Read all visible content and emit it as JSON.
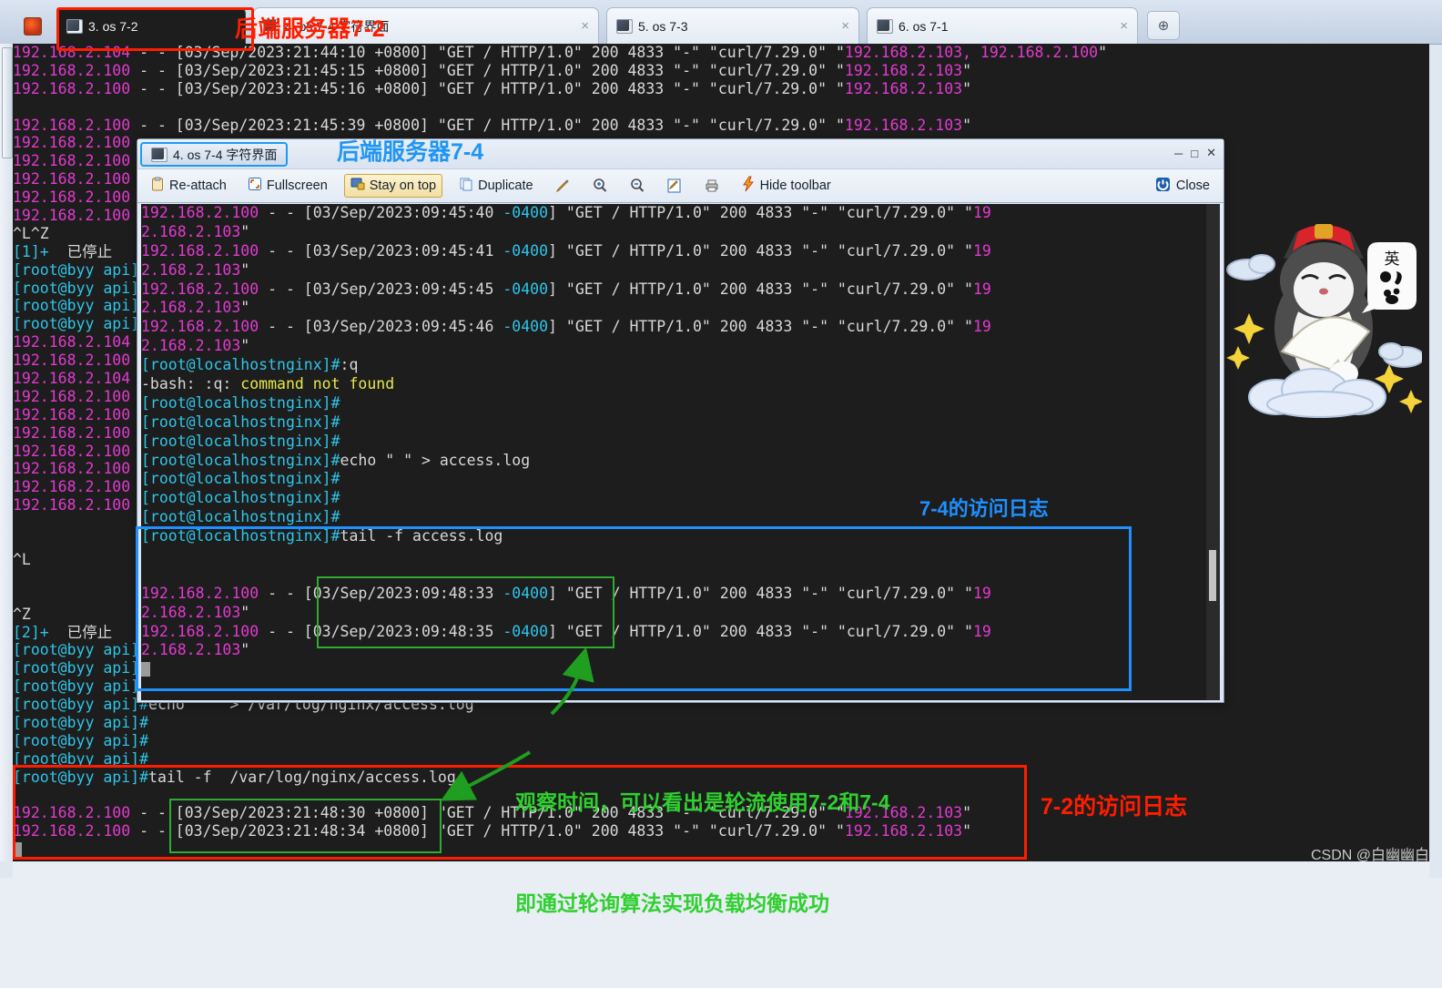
{
  "window": {
    "tabs": [
      {
        "label": "3. os 7-2",
        "icon": "monitor-icon",
        "active": true,
        "close": "×"
      },
      {
        "label": "4. os 7-4 字符界面",
        "icon": "monitor-icon",
        "active": false,
        "close": "×"
      },
      {
        "label": "5. os 7-3",
        "icon": "monitor-icon",
        "active": false,
        "close": "×"
      },
      {
        "label": "6. os 7-1",
        "icon": "monitor-icon",
        "active": false,
        "close": "×"
      }
    ],
    "new_tab_label": "⊕",
    "home_icon": "home-icon"
  },
  "inner_window": {
    "tab_label": "4. os 7-4 字符界面",
    "tab_icon": "monitor-icon",
    "controls": {
      "minimize": "─",
      "maximize": "□",
      "close": "✕"
    },
    "toolbar": {
      "reattach": "Re-attach",
      "fullscreen": "Fullscreen",
      "stayontop": "Stay on top",
      "duplicate": "Duplicate",
      "hidetoolbar": "Hide toolbar",
      "close": "Close",
      "icon_pencil": "pencil-icon",
      "icon_zoom_in": "zoom-in-icon",
      "icon_zoom_out": "zoom-out-icon",
      "icon_edit_doc": "edit-document-icon",
      "icon_print": "printer-icon",
      "icon_lightning": "lightning-icon",
      "icon_power": "power-icon"
    }
  },
  "main_terminal": {
    "lines": [
      {
        "t": "log",
        "ip": "192.168.2.104",
        "rest": " - - [03/Sep/2023:21:44:10 +0800] \"GET / HTTP/1.0\" 200 4833 \"-\" \"curl/7.29.0\" \"",
        "tail_ip": "192.168.2.103, 192.168.2.100",
        "q": "\""
      },
      {
        "t": "log",
        "ip": "192.168.2.100",
        "rest": " - - [03/Sep/2023:21:45:15 +0800] \"GET / HTTP/1.0\" 200 4833 \"-\" \"curl/7.29.0\" \"",
        "tail_ip": "192.168.2.103",
        "q": "\""
      },
      {
        "t": "log",
        "ip": "192.168.2.100",
        "rest": " - - [03/Sep/2023:21:45:16 +0800] \"GET / HTTP/1.0\" 200 4833 \"-\" \"curl/7.29.0\" \"",
        "tail_ip": "192.168.2.103",
        "q": "\""
      },
      {
        "t": "blank"
      },
      {
        "t": "log",
        "ip": "192.168.2.100",
        "rest": " - - [03/Sep/2023:21:45:39 +0800] \"GET / HTTP/1.0\" 200 4833 \"-\" \"curl/7.29.0\" \"",
        "tail_ip": "192.168.2.103",
        "q": "\""
      },
      {
        "t": "ip",
        "ip": "192.168.2.100"
      },
      {
        "t": "ip",
        "ip": "192.168.2.100"
      },
      {
        "t": "ip",
        "ip": "192.168.2.100"
      },
      {
        "t": "ip",
        "ip": "192.168.2.100"
      },
      {
        "t": "ip",
        "ip": "192.168.2.100"
      },
      {
        "t": "plain",
        "text": "^L^Z"
      },
      {
        "t": "job",
        "jid": "[1]+",
        "status": "  已停止"
      },
      {
        "t": "prompt",
        "text": "[root@byy api]#"
      },
      {
        "t": "prompt",
        "text": "[root@byy api]#"
      },
      {
        "t": "prompt",
        "text": "[root@byy api]#"
      },
      {
        "t": "prompt",
        "text": "[root@byy api]#"
      },
      {
        "t": "ip",
        "ip": "192.168.2.104"
      },
      {
        "t": "ip",
        "ip": "192.168.2.100"
      },
      {
        "t": "ip",
        "ip": "192.168.2.104"
      },
      {
        "t": "ip",
        "ip": "192.168.2.100"
      },
      {
        "t": "ip",
        "ip": "192.168.2.100"
      },
      {
        "t": "ip",
        "ip": "192.168.2.100"
      },
      {
        "t": "ip",
        "ip": "192.168.2.100"
      },
      {
        "t": "ip",
        "ip": "192.168.2.100"
      },
      {
        "t": "ip",
        "ip": "192.168.2.100"
      },
      {
        "t": "ip",
        "ip": "192.168.2.100"
      },
      {
        "t": "blank"
      },
      {
        "t": "blank"
      },
      {
        "t": "plain",
        "text": "^L"
      },
      {
        "t": "blank"
      },
      {
        "t": "blank"
      },
      {
        "t": "plain",
        "text": "^Z"
      },
      {
        "t": "job",
        "jid": "[2]+",
        "status": "  已停止"
      },
      {
        "t": "prompt",
        "text": "[root@byy api]#"
      },
      {
        "t": "prompt",
        "text": "[root@byy api]#"
      },
      {
        "t": "prompt",
        "text": "[root@byy api]#"
      },
      {
        "t": "cmd",
        "prompt": "[root@byy api]#",
        "cmd": "echo \" \" > /var/log/nginx/access.log"
      },
      {
        "t": "prompt",
        "text": "[root@byy api]#"
      },
      {
        "t": "prompt",
        "text": "[root@byy api]#"
      },
      {
        "t": "prompt",
        "text": "[root@byy api]#"
      },
      {
        "t": "cmd",
        "prompt": "[root@byy api]#",
        "cmd": "tail -f  /var/log/nginx/access.log"
      },
      {
        "t": "blank"
      },
      {
        "t": "log",
        "ip": "192.168.2.100",
        "rest": " - - [03/Sep/2023:21:48:30 +0800] \"GET / HTTP/1.0\" 200 4833 \"-\" \"curl/7.29.0\" \"",
        "tail_ip": "192.168.2.103",
        "q": "\""
      },
      {
        "t": "log",
        "ip": "192.168.2.100",
        "rest": " - - [03/Sep/2023:21:48:34 +0800] \"GET / HTTP/1.0\" 200 4833 \"-\" \"curl/7.29.0\" \"",
        "tail_ip": "192.168.2.103",
        "q": "\""
      },
      {
        "t": "cursor"
      }
    ]
  },
  "inner_terminal": {
    "lines": [
      {
        "t": "log",
        "ip": "192.168.2.100",
        "mid": " - - [",
        "ts": "03/Sep/2023:09:45:40 ",
        "tz": "-0400",
        "close": "] ",
        "rest": "\"GET / HTTP/1.0\" 200 4833 \"-\" \"curl/7.29.0\" \"",
        "wrap_ip": "19"
      },
      {
        "t": "wrap",
        "ip": "2.168.2.103",
        "q": "\""
      },
      {
        "t": "log",
        "ip": "192.168.2.100",
        "mid": " - - [",
        "ts": "03/Sep/2023:09:45:41 ",
        "tz": "-0400",
        "close": "] ",
        "rest": "\"GET / HTTP/1.0\" 200 4833 \"-\" \"curl/7.29.0\" \"",
        "wrap_ip": "19"
      },
      {
        "t": "wrap",
        "ip": "2.168.2.103",
        "q": "\""
      },
      {
        "t": "log",
        "ip": "192.168.2.100",
        "mid": " - - [",
        "ts": "03/Sep/2023:09:45:45 ",
        "tz": "-0400",
        "close": "] ",
        "rest": "\"GET / HTTP/1.0\" 200 4833 \"-\" \"curl/7.29.0\" \"",
        "wrap_ip": "19"
      },
      {
        "t": "wrap",
        "ip": "2.168.2.103",
        "q": "\""
      },
      {
        "t": "log",
        "ip": "192.168.2.100",
        "mid": " - - [",
        "ts": "03/Sep/2023:09:45:46 ",
        "tz": "-0400",
        "close": "] ",
        "rest": "\"GET / HTTP/1.0\" 200 4833 \"-\" \"curl/7.29.0\" \"",
        "wrap_ip": "19"
      },
      {
        "t": "wrap",
        "ip": "2.168.2.103",
        "q": "\""
      },
      {
        "t": "cmd",
        "prompt": "[root@localhostnginx]#",
        "cmd": ":q"
      },
      {
        "t": "err",
        "pre": "-bash: :q: ",
        "msg": "command not found"
      },
      {
        "t": "prompt",
        "text": "[root@localhostnginx]#"
      },
      {
        "t": "prompt",
        "text": "[root@localhostnginx]#"
      },
      {
        "t": "prompt",
        "text": "[root@localhostnginx]#"
      },
      {
        "t": "cmd",
        "prompt": "[root@localhostnginx]#",
        "cmd": "echo \" \" > access.log"
      },
      {
        "t": "prompt",
        "text": "[root@localhostnginx]#"
      },
      {
        "t": "prompt",
        "text": "[root@localhostnginx]#"
      },
      {
        "t": "prompt",
        "text": "[root@localhostnginx]#"
      },
      {
        "t": "cmd",
        "prompt": "[root@localhostnginx]#",
        "cmd": "tail -f access.log"
      },
      {
        "t": "blank"
      },
      {
        "t": "blank"
      },
      {
        "t": "log",
        "ip": "192.168.2.100",
        "mid": " - - [",
        "ts": "03/Sep/2023:09:48:33 ",
        "tz": "-0400",
        "close": "] ",
        "rest": "\"GET / HTTP/1.0\" 200 4833 \"-\" \"curl/7.29.0\" \"",
        "wrap_ip": "19"
      },
      {
        "t": "wrap",
        "ip": "2.168.2.103",
        "q": "\""
      },
      {
        "t": "log",
        "ip": "192.168.2.100",
        "mid": " - - [",
        "ts": "03/Sep/2023:09:48:35 ",
        "tz": "-0400",
        "close": "] ",
        "rest": "\"GET / HTTP/1.0\" 200 4833 \"-\" \"curl/7.29.0\" \"",
        "wrap_ip": "19"
      },
      {
        "t": "wrap",
        "ip": "2.168.2.103",
        "q": "\""
      },
      {
        "t": "cursor"
      }
    ]
  },
  "annotations": {
    "tab_7_2": "后端服务器7-2",
    "window_7_4": "后端服务器7-4",
    "log_7_4": "7-4的访问日志",
    "log_7_2": "7-2的访问日志",
    "explanation_line1": "观察时间，可以看出是轮流使用7-2和7-4",
    "explanation_line2": "即通过轮询算法实现负载均衡成功"
  },
  "watermark": "CSDN @白幽幽白",
  "colors": {
    "terminal_bg": "#1d1d1d",
    "ip_magenta": "#e23ad0",
    "prompt_cyan": "#2ec5e8",
    "warn_yellow": "#e8e84a",
    "annot_red": "#ff1d00",
    "annot_blue": "#1e90ff",
    "annot_green": "#2fd02f"
  },
  "decor": {
    "cat_sticker": "cat-sticker-image"
  }
}
